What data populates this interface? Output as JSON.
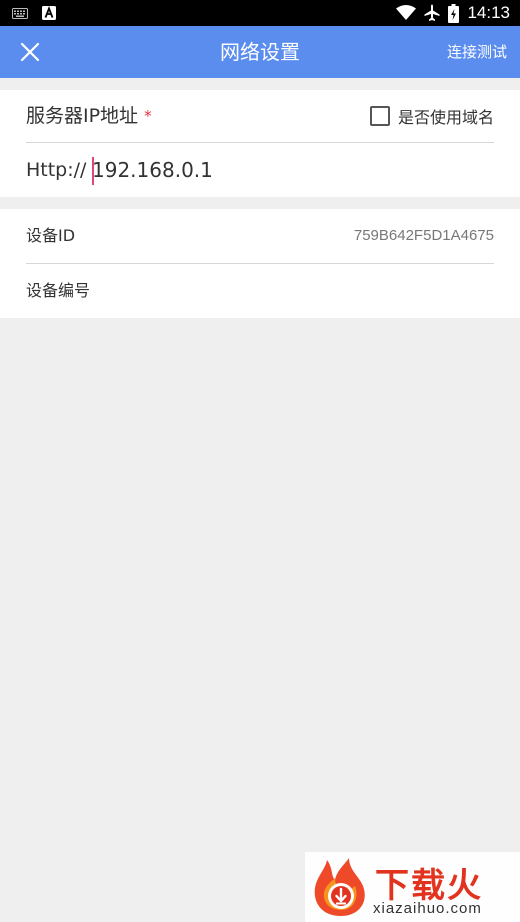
{
  "status_bar": {
    "time": "14:13",
    "left_icons": [
      "keyboard-icon",
      "a-notification-icon"
    ],
    "right_icons": [
      "wifi-icon",
      "airplane-icon",
      "battery-icon"
    ]
  },
  "toolbar": {
    "title": "网络设置",
    "action_label": "连接测试",
    "close_icon": "close-icon",
    "background_color": "#5b8def"
  },
  "server_section": {
    "label": "服务器IP地址",
    "required_mark": "*",
    "domain_checkbox_label": "是否使用域名",
    "domain_checked": false,
    "url_prefix": "Http://",
    "ip_value": "192.168.0.1"
  },
  "device_section": {
    "id_label": "设备ID",
    "id_value": "759B642F5D1A4675",
    "number_label": "设备编号",
    "number_value": ""
  },
  "watermark": {
    "brand": "下载火",
    "domain": "xiazaihuo.com"
  }
}
